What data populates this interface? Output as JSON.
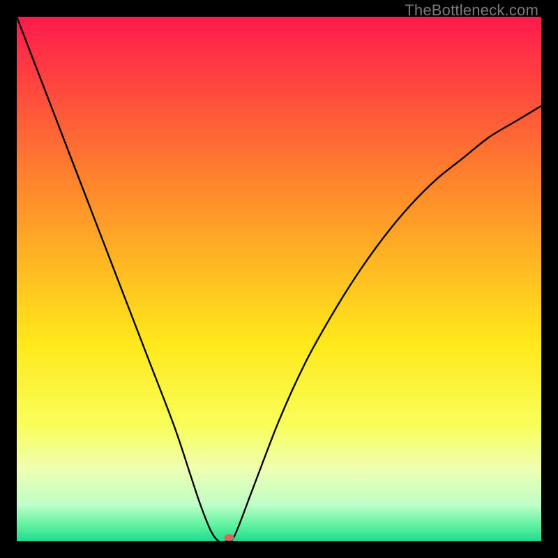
{
  "watermark": "TheBottleneck.com",
  "chart_data": {
    "type": "line",
    "title": "",
    "xlabel": "",
    "ylabel": "",
    "xlim": [
      0,
      100
    ],
    "ylim": [
      0,
      100
    ],
    "grid": false,
    "legend": false,
    "background_gradient": {
      "stops": [
        {
          "offset": 0.0,
          "color": "#ff1a4b"
        },
        {
          "offset": 0.33,
          "color": "#ff8a2a"
        },
        {
          "offset": 0.62,
          "color": "#ffe81a"
        },
        {
          "offset": 0.78,
          "color": "#f8ff5a"
        },
        {
          "offset": 0.86,
          "color": "#f0ffb0"
        },
        {
          "offset": 0.93,
          "color": "#bfffc8"
        },
        {
          "offset": 0.97,
          "color": "#5ff2a0"
        },
        {
          "offset": 1.0,
          "color": "#1fd98f"
        }
      ]
    },
    "series": [
      {
        "name": "bottleneck-curve",
        "x": [
          0,
          5,
          10,
          15,
          20,
          25,
          30,
          33,
          35,
          37,
          38.5,
          40,
          41.5,
          45,
          50,
          55,
          60,
          65,
          70,
          75,
          80,
          85,
          90,
          95,
          100
        ],
        "values": [
          100,
          87,
          74,
          61,
          48,
          35,
          22,
          13,
          7,
          2,
          0,
          0,
          1,
          10,
          23,
          34,
          43,
          51,
          58,
          64,
          69,
          73,
          77,
          80,
          83
        ]
      }
    ],
    "marker": {
      "x": 40.5,
      "y": 0.7,
      "color": "#d16a5a",
      "rx": 7,
      "ry": 5
    }
  }
}
